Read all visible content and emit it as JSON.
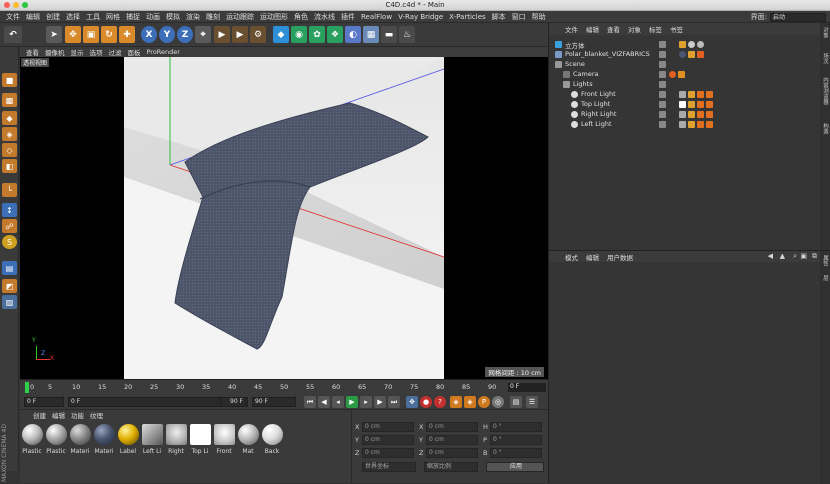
{
  "window": {
    "title": "C4D.c4d * - Main"
  },
  "menubar": {
    "items": [
      "文件",
      "编辑",
      "创建",
      "选择",
      "工具",
      "网格",
      "捕捉",
      "动画",
      "模拟",
      "渲染",
      "雕刻",
      "运动跟踪",
      "运动图形",
      "角色",
      "流水线",
      "插件",
      "RealFlow",
      "V-Ray Bridge",
      "X-Particles",
      "脚本",
      "窗口",
      "帮助"
    ],
    "layout_label": "界面:",
    "layout_value": "启动"
  },
  "toolbar": {
    "axis_x": "X",
    "axis_y": "Y",
    "axis_z": "Z"
  },
  "viewport": {
    "menu": [
      "查看",
      "摄像机",
      "显示",
      "选项",
      "过滤",
      "面板",
      "ProRender"
    ],
    "label": "透视视图",
    "grid_info": "网格间距 : 10 cm",
    "axis_y": "Y",
    "axis_z": "Z",
    "axis_x": "X"
  },
  "timeline": {
    "ticks": [
      "0",
      "5",
      "10",
      "15",
      "20",
      "25",
      "30",
      "35",
      "40",
      "45",
      "50",
      "55",
      "60",
      "65",
      "70",
      "75",
      "80",
      "85",
      "90"
    ],
    "current_frame": "0 F",
    "start_field": "0 F",
    "min_field": "0 F",
    "end_field": "90 F",
    "max_field": "90 F"
  },
  "materials": {
    "menu": [
      "创建",
      "编辑",
      "功能",
      "纹理"
    ],
    "items": [
      {
        "label": "Plastic",
        "color": "#bdbdbd"
      },
      {
        "label": "Plastic",
        "color": "#a8a8a8"
      },
      {
        "label": "Materi",
        "color": "#8a8a8a"
      },
      {
        "label": "Materi",
        "color": "#4b5670"
      },
      {
        "label": "Label",
        "color": "#e0b000"
      },
      {
        "label": "Left Li",
        "color": "#9a9a9a"
      },
      {
        "label": "Right",
        "color": "#b0b0b0"
      },
      {
        "label": "Top Li",
        "color": "#ffffff"
      },
      {
        "label": "Front",
        "color": "#c8c8c8"
      },
      {
        "label": "Mat",
        "color": "#bbbbbb"
      },
      {
        "label": "Back",
        "color": "#dddddd"
      }
    ]
  },
  "coordinates": {
    "rows": [
      {
        "a_label": "X",
        "a_val": "0 cm",
        "b_label": "X",
        "b_val": "0 cm",
        "c_label": "H",
        "c_val": "0 °"
      },
      {
        "a_label": "Y",
        "a_val": "0 cm",
        "b_label": "Y",
        "b_val": "0 cm",
        "c_label": "P",
        "c_val": "0 °"
      },
      {
        "a_label": "Z",
        "a_val": "0 cm",
        "b_label": "Z",
        "b_val": "0 cm",
        "c_label": "B",
        "c_val": "0 °"
      }
    ],
    "world_select": "世界坐标",
    "scale_select": "缩放比例",
    "apply_button": "应用"
  },
  "object_manager": {
    "menu": [
      "文件",
      "编辑",
      "查看",
      "对象",
      "标签",
      "书签"
    ],
    "objects": [
      {
        "name": "立方体",
        "indent": 0
      },
      {
        "name": "Polar_blanket_VIZFABRICS",
        "indent": 0
      },
      {
        "name": "Scene",
        "indent": 0
      },
      {
        "name": "Camera",
        "indent": 1
      },
      {
        "name": "Lights",
        "indent": 1
      },
      {
        "name": "Front Light",
        "indent": 2
      },
      {
        "name": "Top Light",
        "indent": 2
      },
      {
        "name": "Right Light",
        "indent": 2
      },
      {
        "name": "Left Light",
        "indent": 2
      }
    ],
    "side_tabs": [
      "对象",
      "场次",
      "内容浏览器",
      "构造"
    ]
  },
  "attribute_manager": {
    "menu": [
      "模式",
      "编辑",
      "用户数据"
    ],
    "side_tabs": [
      "属性",
      "层"
    ]
  },
  "brand": {
    "text": "MAXON CINEMA 4D"
  }
}
